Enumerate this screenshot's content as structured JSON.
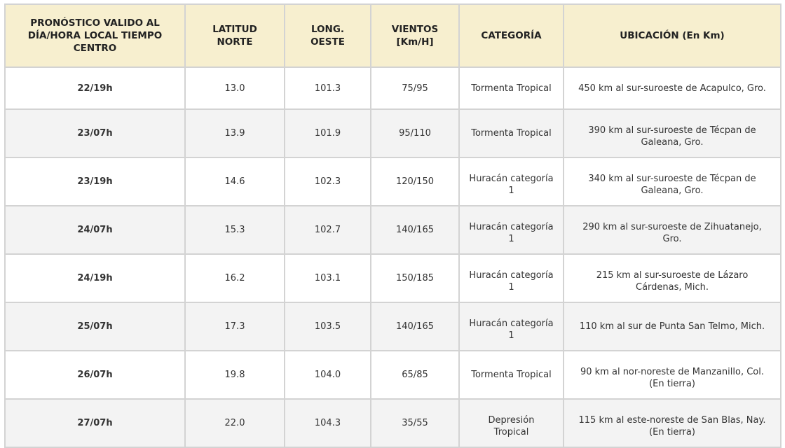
{
  "table": {
    "headers": [
      "PRONÓSTICO VALIDO AL DÍA/HORA LOCAL TIEMPO CENTRO",
      "LATITUD NORTE",
      "LONG. OESTE",
      "VIENTOS [Km/H]",
      "CATEGORÍA",
      "UBICACIÓN (En Km)"
    ],
    "header_lines": [
      [
        "PRONÓSTICO VALIDO AL",
        "DÍA/HORA LOCAL TIEMPO",
        "CENTRO"
      ],
      [
        "LATITUD",
        "NORTE"
      ],
      [
        "LONG.",
        "OESTE"
      ],
      [
        "VIENTOS",
        "[Km/H]"
      ],
      [
        "CATEGORÍA"
      ],
      [
        "UBICACIÓN (En Km)"
      ]
    ],
    "rows": [
      {
        "fecha": "22/19h",
        "latitud": "13.0",
        "longitud": "101.3",
        "vientos": "75/95",
        "categoria": [
          "Tormenta Tropical"
        ],
        "ubicacion": [
          "450 km al sur-suroeste de Acapulco, Gro."
        ]
      },
      {
        "fecha": "23/07h",
        "latitud": "13.9",
        "longitud": "101.9",
        "vientos": "95/110",
        "categoria": [
          "Tormenta Tropical"
        ],
        "ubicacion": [
          "390 km al sur-suroeste de Técpan de",
          "Galeana, Gro."
        ]
      },
      {
        "fecha": "23/19h",
        "latitud": "14.6",
        "longitud": "102.3",
        "vientos": "120/150",
        "categoria": [
          "Huracán categoría",
          "1"
        ],
        "ubicacion": [
          "340 km al sur-suroeste de Técpan de",
          "Galeana, Gro."
        ]
      },
      {
        "fecha": "24/07h",
        "latitud": "15.3",
        "longitud": "102.7",
        "vientos": "140/165",
        "categoria": [
          "Huracán categoría",
          "1"
        ],
        "ubicacion": [
          "290 km al sur-suroeste de Zihuatanejo,",
          "Gro."
        ]
      },
      {
        "fecha": "24/19h",
        "latitud": "16.2",
        "longitud": "103.1",
        "vientos": "150/185",
        "categoria": [
          "Huracán categoría",
          "1"
        ],
        "ubicacion": [
          "215 km al sur-suroeste de Lázaro",
          "Cárdenas, Mich."
        ]
      },
      {
        "fecha": "25/07h",
        "latitud": "17.3",
        "longitud": "103.5",
        "vientos": "140/165",
        "categoria": [
          "Huracán categoría",
          "1"
        ],
        "ubicacion": [
          "110 km al sur de Punta San Telmo, Mich."
        ]
      },
      {
        "fecha": "26/07h",
        "latitud": "19.8",
        "longitud": "104.0",
        "vientos": "65/85",
        "categoria": [
          "Tormenta Tropical"
        ],
        "ubicacion": [
          "90 km al nor-noreste de Manzanillo, Col.",
          "(En tierra)"
        ]
      },
      {
        "fecha": "27/07h",
        "latitud": "22.0",
        "longitud": "104.3",
        "vientos": "35/55",
        "categoria": [
          "Depresión",
          "Tropical"
        ],
        "ubicacion": [
          "115 km al este-noreste de San Blas, Nay.",
          "(En tierra)"
        ]
      }
    ]
  },
  "colors": {
    "header_bg": "#f7efcf",
    "row_alt_bg": "#f3f3f3",
    "border": "#d3d3d3",
    "text": "#333333"
  }
}
